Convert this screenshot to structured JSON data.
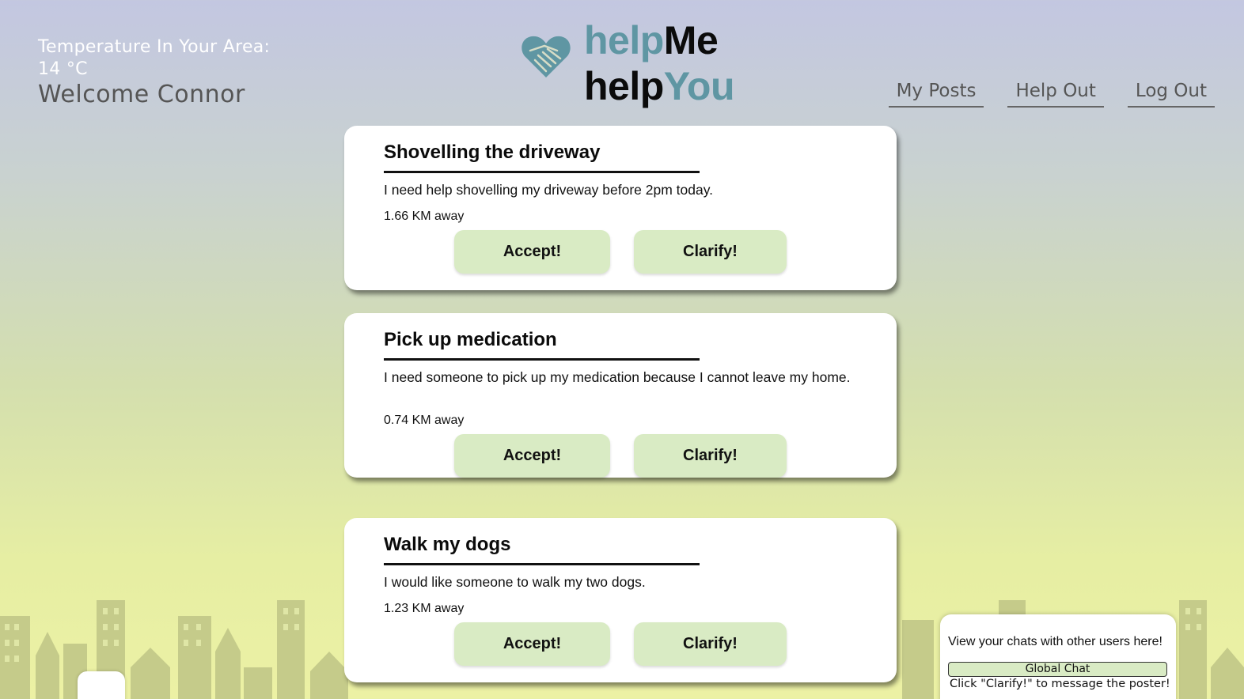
{
  "header": {
    "weather_label": "Temperature In Your Area:",
    "weather_value": "14 °C",
    "welcome": "Welcome Connor"
  },
  "logo": {
    "line1_a": "help",
    "line1_b": "Me",
    "line2_a": "help",
    "line2_b": "You",
    "icon": "heart-handshake-icon",
    "color_teal": "#5f96a3"
  },
  "nav": {
    "my_posts": "My Posts",
    "help_out": "Help Out",
    "log_out": "Log Out"
  },
  "posts": [
    {
      "title": "Shovelling the driveway",
      "description": "I need help shovelling my driveway before 2pm today.",
      "distance": "1.66 KM away",
      "accept": "Accept!",
      "clarify": "Clarify!"
    },
    {
      "title": "Pick up medication",
      "description": "I need someone to pick up my medication because I cannot leave my home.",
      "distance": "0.74 KM away",
      "accept": "Accept!",
      "clarify": "Clarify!"
    },
    {
      "title": "Walk my dogs",
      "description": "I would like someone to walk my two dogs.",
      "distance": "1.23 KM away",
      "accept": "Accept!",
      "clarify": "Clarify!"
    }
  ],
  "chat": {
    "intro": "View your chats with other users here!",
    "global_button": "Global Chat",
    "hint": "Click \"Clarify!\" to message the poster!"
  },
  "colors": {
    "button_green": "#d9ebc4",
    "skyline": "#c3c98a"
  }
}
